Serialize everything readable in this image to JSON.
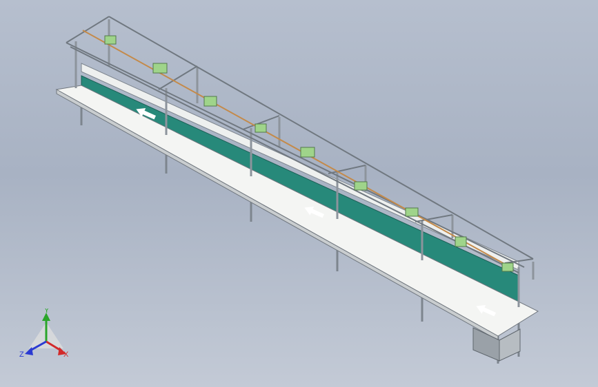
{
  "viewport": {
    "background_top": "#b6bfce",
    "background_bottom": "#c3cad6"
  },
  "model": {
    "name": "assembly-line-conveyor",
    "belt_color": "#27897a",
    "frame_color": "#8d949c",
    "tabletop_color": "#f4f5f3",
    "light_strip_color": "#c48a4a",
    "panel_color": "#9fd48a",
    "direction_arrows": [
      "arrow-icon",
      "arrow-icon",
      "arrow-icon"
    ]
  },
  "triad": {
    "x_label": "X",
    "y_label": "Y",
    "z_label": "Z",
    "x_color": "#d22a2a",
    "y_color": "#2aa52a",
    "z_color": "#2a3ad2"
  }
}
